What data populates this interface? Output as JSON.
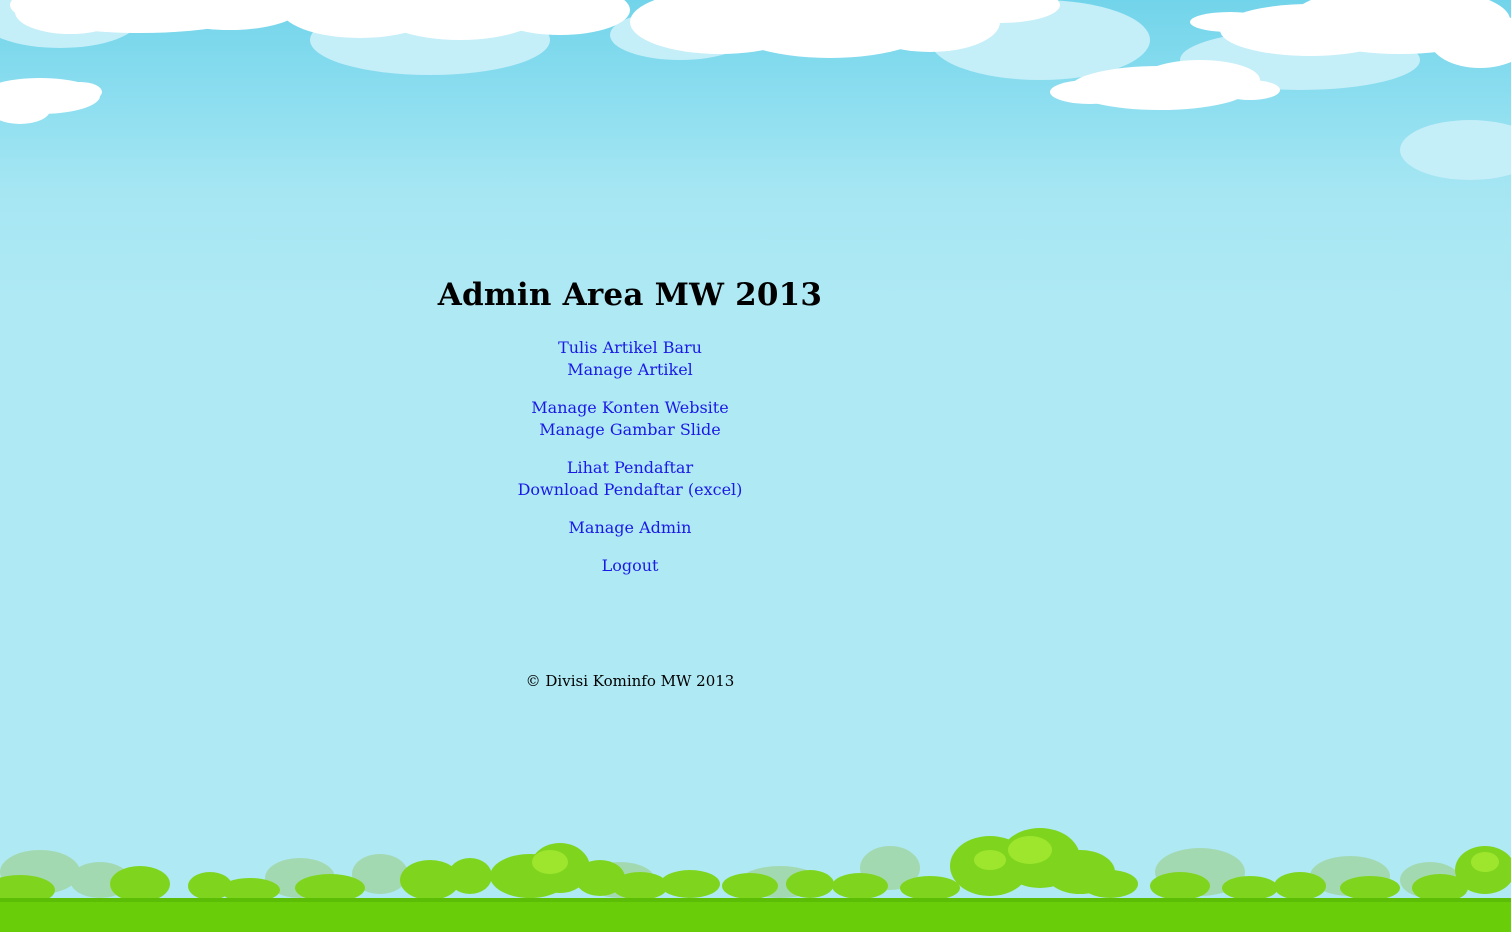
{
  "header": {
    "title": "Admin Area MW 2013"
  },
  "menu": {
    "groups": [
      {
        "items": [
          {
            "label": "Tulis Artikel Baru"
          },
          {
            "label": "Manage Artikel"
          }
        ]
      },
      {
        "items": [
          {
            "label": "Manage Konten Website"
          },
          {
            "label": "Manage Gambar Slide"
          }
        ]
      },
      {
        "items": [
          {
            "label": "Lihat Pendaftar"
          },
          {
            "label": "Download Pendaftar (excel)"
          }
        ]
      },
      {
        "items": [
          {
            "label": "Manage Admin"
          }
        ]
      },
      {
        "items": [
          {
            "label": "Logout"
          }
        ]
      }
    ]
  },
  "footer": {
    "copyright": "© Divisi Kominfo MW 2013"
  },
  "colors": {
    "link": "#1a1ae6",
    "sky": "#aee9f4",
    "grass": "#6acd0a"
  }
}
